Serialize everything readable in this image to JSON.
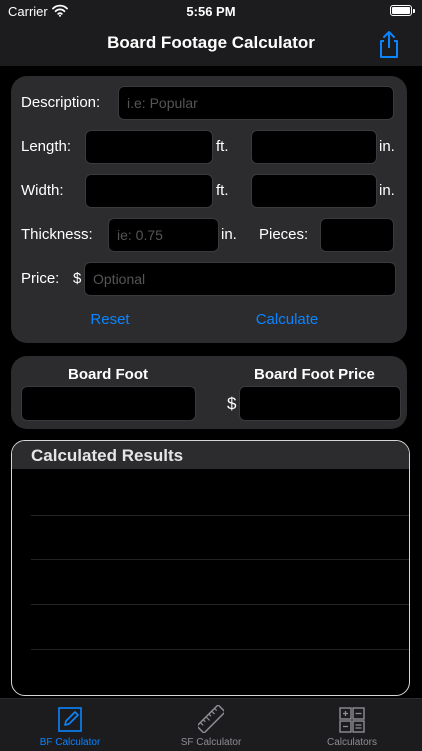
{
  "status_bar": {
    "carrier": "Carrier",
    "time": "5:56 PM"
  },
  "nav": {
    "title": "Board Footage Calculator",
    "share_icon": "share-icon"
  },
  "form": {
    "description_label": "Description:",
    "description_placeholder": "i.e: Popular",
    "description_value": "",
    "length_label": "Length:",
    "length_ft_value": "",
    "length_ft_unit": "ft.",
    "length_in_value": "",
    "length_in_unit": "in.",
    "width_label": "Width:",
    "width_ft_value": "",
    "width_ft_unit": "ft.",
    "width_in_value": "",
    "width_in_unit": "in.",
    "thickness_label": "Thickness:",
    "thickness_placeholder": "ie: 0.75",
    "thickness_value": "",
    "thickness_unit": "in.",
    "pieces_label": "Pieces:",
    "pieces_value": "",
    "price_label": "Price:",
    "price_currency": "$",
    "price_placeholder": "Optional",
    "price_value": "",
    "reset_label": "Reset",
    "calculate_label": "Calculate"
  },
  "output": {
    "board_foot_label": "Board Foot",
    "board_foot_value": "",
    "board_foot_price_label": "Board Foot Price",
    "currency": "$",
    "board_foot_price_value": ""
  },
  "results": {
    "title": "Calculated Results",
    "rows": []
  },
  "tabs": [
    {
      "label": "BF Calculator",
      "icon": "pencil-square-icon",
      "active": true
    },
    {
      "label": "SF Calculator",
      "icon": "ruler-icon",
      "active": false
    },
    {
      "label": "Calculators",
      "icon": "calculator-icon",
      "active": false
    }
  ],
  "colors": {
    "accent": "#0a84ff",
    "inactive": "#8e8e93",
    "panel": "#2c2c2e",
    "background": "#000000"
  }
}
